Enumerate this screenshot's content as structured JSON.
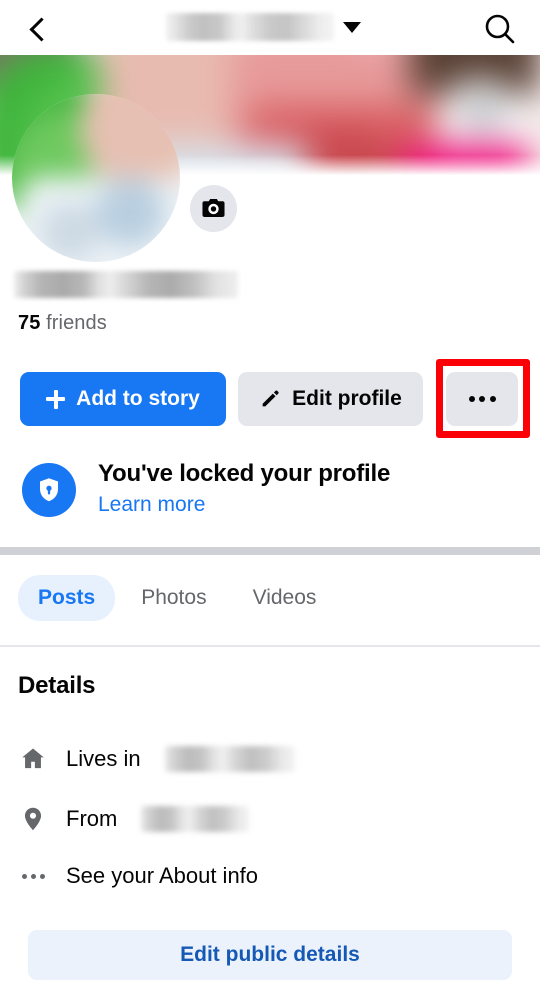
{
  "header": {
    "back_icon": "chevron-left-icon",
    "profile_name": "",
    "dropdown_icon": "caret-down-icon",
    "search_icon": "search-icon"
  },
  "cover": {
    "camera_icon": "camera-icon"
  },
  "profile": {
    "display_name": "",
    "friends_count": "75",
    "friends_label": "friends"
  },
  "actions": {
    "add_story_label": "Add to story",
    "add_story_icon": "plus-icon",
    "edit_profile_label": "Edit profile",
    "edit_profile_icon": "pencil-icon",
    "more_icon": "ellipsis-icon"
  },
  "highlight": {
    "color": "#fb0007",
    "target": "more-options-button"
  },
  "locked_notice": {
    "icon": "shield-lock-icon",
    "title": "You've locked your profile",
    "link_label": "Learn more"
  },
  "tabs": [
    {
      "label": "Posts",
      "active": true
    },
    {
      "label": "Photos",
      "active": false
    },
    {
      "label": "Videos",
      "active": false
    }
  ],
  "details": {
    "heading": "Details",
    "rows": [
      {
        "icon": "home-icon",
        "label": "Lives in",
        "value": ""
      },
      {
        "icon": "location-pin-icon",
        "label": "From",
        "value": ""
      },
      {
        "icon": "ellipsis-icon",
        "label": "See your About info",
        "value": ""
      }
    ],
    "edit_public_label": "Edit public details"
  },
  "colors": {
    "brand_blue": "#1877f2",
    "button_gray": "#e4e6eb",
    "text_primary": "#050505",
    "text_secondary": "#65676b",
    "highlight_red": "#fb0007"
  }
}
